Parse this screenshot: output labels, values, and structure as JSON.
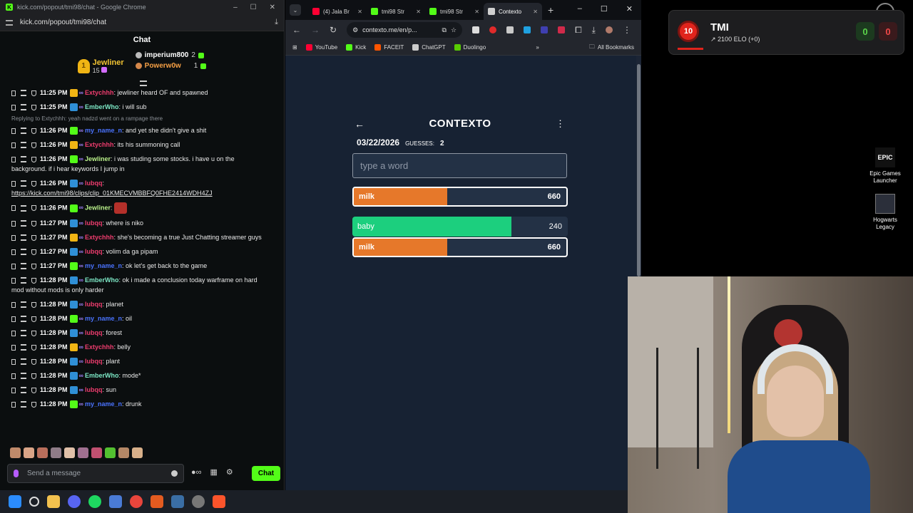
{
  "chat_window": {
    "title": "kick.com/popout/tmi98/chat - Google Chrome",
    "url": "kick.com/popout/tmi98/chat",
    "heading": "Chat",
    "leaderboard": {
      "first": {
        "name": "Jewliner",
        "count": "15"
      },
      "second": {
        "name": "imperium800",
        "count": "2"
      },
      "third": {
        "name": "Powerw0w",
        "count": "1"
      }
    },
    "messages": [
      {
        "time": "11:25 PM",
        "user": "Extychhh",
        "text": ": jewliner heard OF and spawned",
        "color": "u-pink",
        "badge": "b-gold"
      },
      {
        "time": "11:25 PM",
        "user": "EmberWho",
        "text": ": i will sub",
        "color": "u-mint",
        "badge": "b-blue"
      },
      {
        "reply": "Replying to Extychhh: yeah nadzd went on a rampage there"
      },
      {
        "time": "11:26 PM",
        "user": "my_name_n",
        "text": ": and yet she didn't give a shit",
        "color": "u-blue",
        "badge": "b-green"
      },
      {
        "time": "11:26 PM",
        "user": "Extychhh",
        "text": ": its his summoning call",
        "color": "u-pink",
        "badge": "b-gold"
      },
      {
        "time": "11:26 PM",
        "user": "Jewliner",
        "text": ": i was studing some stocks. i have u on the background. if i hear keywords I jump in",
        "color": "u-lime",
        "badge": "b-green"
      },
      {
        "time": "11:26 PM",
        "user": "lubqq",
        "text": ":",
        "link": "https://kick.com/tmi98/clips/clip_01KMECVMBBFQ0FHE2414WDH4ZJ",
        "color": "u-pink",
        "badge": "b-blue"
      },
      {
        "time": "11:26 PM",
        "user": "Jewliner",
        "text": ":",
        "emote": true,
        "color": "u-lime",
        "badge": "b-green"
      },
      {
        "time": "11:27 PM",
        "user": "lubqq",
        "text": ": where is niko",
        "color": "u-pink",
        "badge": "b-blue"
      },
      {
        "time": "11:27 PM",
        "user": "Extychhh",
        "text": ": she's becoming a true Just Chatting streamer guys",
        "color": "u-pink",
        "badge": "b-gold"
      },
      {
        "time": "11:27 PM",
        "user": "lubqq",
        "text": ": volim da ga pipam",
        "color": "u-pink",
        "badge": "b-blue"
      },
      {
        "time": "11:27 PM",
        "user": "my_name_n",
        "text": ": ok let's get back to the game",
        "color": "u-blue",
        "badge": "b-green"
      },
      {
        "time": "11:28 PM",
        "user": "EmberWho",
        "text": ": ok i made a conclusion today warframe on hard mod without mods is only harder",
        "color": "u-mint",
        "badge": "b-blue"
      },
      {
        "time": "11:28 PM",
        "user": "lubqq",
        "text": ": planet",
        "color": "u-pink",
        "badge": "b-blue"
      },
      {
        "time": "11:28 PM",
        "user": "my_name_n",
        "text": ": oil",
        "color": "u-blue",
        "badge": "b-green"
      },
      {
        "time": "11:28 PM",
        "user": "lubqq",
        "text": ": forest",
        "color": "u-pink",
        "badge": "b-blue"
      },
      {
        "time": "11:28 PM",
        "user": "Extychhh",
        "text": ": belly",
        "color": "u-pink",
        "badge": "b-gold"
      },
      {
        "time": "11:28 PM",
        "user": "lubqq",
        "text": ": plant",
        "color": "u-pink",
        "badge": "b-blue"
      },
      {
        "time": "11:28 PM",
        "user": "EmberWho",
        "text": ": mode*",
        "color": "u-mint",
        "badge": "b-blue"
      },
      {
        "time": "11:28 PM",
        "user": "lubqq",
        "text": ": sun",
        "color": "u-pink",
        "badge": "b-blue"
      },
      {
        "time": "11:28 PM",
        "user": "my_name_n",
        "text": ": drunk",
        "color": "u-blue",
        "badge": "b-green"
      }
    ],
    "input_placeholder": "Send a message",
    "send_label": "Chat"
  },
  "browser": {
    "tabs": [
      {
        "label": "(4) Jala Br",
        "color": "#ff0033"
      },
      {
        "label": "tmi98 Str",
        "color": "#53fc18"
      },
      {
        "label": "tmi98 Str",
        "color": "#53fc18"
      },
      {
        "label": "Contexto",
        "color": "#d0d0d0",
        "active": true
      }
    ],
    "url": "contexto.me/en/p...",
    "bookmarks": [
      {
        "label": "YouTube",
        "color": "#ff0033"
      },
      {
        "label": "Kick",
        "color": "#53fc18"
      },
      {
        "label": "FACEIT",
        "color": "#ff5500"
      },
      {
        "label": "ChatGPT",
        "color": "#cccccc"
      },
      {
        "label": "Duolingo",
        "color": "#58cc02"
      }
    ],
    "all_bookmarks": "All Bookmarks"
  },
  "contexto": {
    "title": "CONTEXTO",
    "date": "03/22/2026",
    "guesses_label": "GUESSES:",
    "guesses_value": "2",
    "placeholder": "type a word",
    "last_guess": {
      "word": "milk",
      "rank": "660",
      "fill": 0.44,
      "color": "#e6782a"
    },
    "guesses": [
      {
        "word": "baby",
        "rank": "240",
        "fill": 0.74,
        "color": "#1ccf7e"
      },
      {
        "word": "milk",
        "rank": "660",
        "fill": 0.44,
        "color": "#e6782a"
      }
    ]
  },
  "faceit": {
    "level": "10",
    "name": "TMI",
    "elo": "2100 ELO (+0)",
    "wins": "0",
    "losses": "0"
  },
  "desktop_icons": [
    {
      "label": "Epic Games Launcher",
      "logo": "EPIC"
    },
    {
      "label": "Hogwarts Legacy"
    }
  ]
}
